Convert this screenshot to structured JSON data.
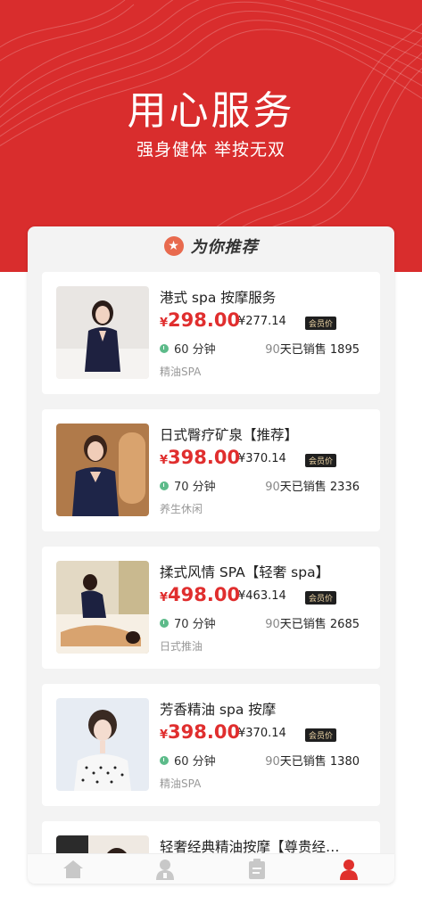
{
  "hero": {
    "title": "用心服务",
    "subtitle": "强身健体  举按无双"
  },
  "section": {
    "title": "为你推荐",
    "icon": "star-icon"
  },
  "currency": "¥",
  "products": [
    {
      "name": "港式 spa 按摩服务",
      "price": "298.00",
      "member_price": "¥277.14",
      "member_tag": "会员价",
      "duration": "60 分钟",
      "sales_count": "90",
      "sales_text": "天已销售 1895",
      "category": "精油SPA"
    },
    {
      "name": "日式臀疗矿泉【推荐】",
      "price": "398.00",
      "member_price": "¥370.14",
      "member_tag": "会员价",
      "duration": "70 分钟",
      "sales_count": "90",
      "sales_text": "天已销售 2336",
      "category": "养生休闲"
    },
    {
      "name": "揉式风情 SPA【轻奢 spa】",
      "price": "498.00",
      "member_price": "¥463.14",
      "member_tag": "会员价",
      "duration": "70 分钟",
      "sales_count": "90",
      "sales_text": "天已销售 2685",
      "category": "日式推油"
    },
    {
      "name": "芳香精油 spa 按摩",
      "price": "398.00",
      "member_price": "¥370.14",
      "member_tag": "会员价",
      "duration": "60 分钟",
      "sales_count": "90",
      "sales_text": "天已销售 1380",
      "category": "精油SPA"
    },
    {
      "name": "轻奢经典精油按摩【尊贵经…"
    }
  ],
  "tabbar": [
    {
      "icon": "home-icon",
      "active": false
    },
    {
      "icon": "technician-icon",
      "active": false
    },
    {
      "icon": "orders-icon",
      "active": false
    },
    {
      "icon": "profile-icon",
      "active": true
    }
  ],
  "colors": {
    "brand": "#d92d2d",
    "price": "#e02e2e",
    "inactive_icon": "#c8c8c8"
  }
}
